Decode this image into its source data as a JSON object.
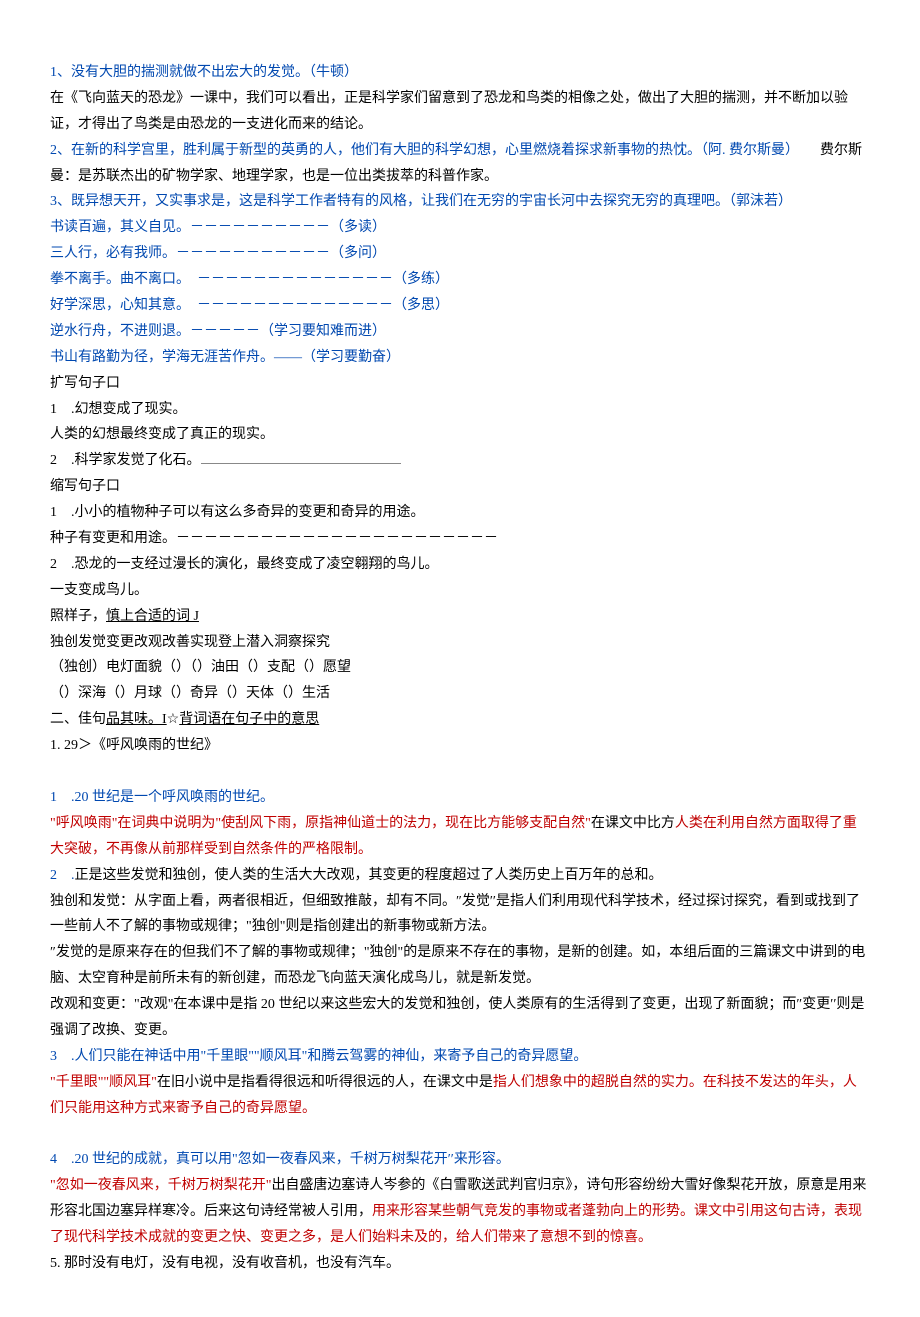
{
  "lines": [
    {
      "cls": "blue",
      "text": "1、没有大胆的揣测就做不出宏大的发觉。（牛顿）"
    },
    {
      "cls": "black",
      "text": "在《飞向蓝天的恐龙》一课中，我们可以看出，正是科学家们留意到了恐龙和鸟类的相像之处，做出了大胆的揣测，并不断加以验证，才得出了鸟类是由恐龙的一支进化而来的结论。"
    },
    {
      "cls": "mix",
      "parts": [
        {
          "cls": "blue",
          "text": "2、在新的科学宫里，胜利属于新型的英勇的人，他们有大胆的科学幻想，心里燃烧着探求新事物的热忱。（阿. 费尔斯曼）"
        },
        {
          "cls": "black",
          "text": "　　费尔斯曼：是苏联杰出的矿物学家、地理学家，也是一位出类拔萃的科普作家。"
        }
      ]
    },
    {
      "cls": "blue",
      "text": "3、既异想天开，又实事求是，这是科学工作者特有的风格，让我们在无穷的宇宙长河中去探究无穷的真理吧。（郭沫若）"
    },
    {
      "cls": "blue",
      "text": "书读百遍，其义自见。－－－－－－－－－－（多读）"
    },
    {
      "cls": "blue",
      "text": "三人行，必有我师。－－－－－－－－－－－（多问）"
    },
    {
      "cls": "blue",
      "text": "拳不离手。曲不离口。　－－－－－－－－－－－－－－（多练）"
    },
    {
      "cls": "blue",
      "text": "好学深思，心知其意。　－－－－－－－－－－－－－－（多思）"
    },
    {
      "cls": "blue",
      "text": "逆水行舟，不进则退。－－－－－（学习要知难而进）"
    },
    {
      "cls": "blue",
      "text": "书山有路勤为径，学海无涯苦作舟。——（学习要勤奋）"
    },
    {
      "cls": "black",
      "text": "扩写句子口"
    },
    {
      "cls": "black",
      "text": "1　.幻想变成了现实。"
    },
    {
      "cls": "black",
      "text": "人类的幻想最终变成了真正的现实。"
    },
    {
      "cls": "mix",
      "parts": [
        {
          "cls": "black",
          "text": "2　.科学家发觉了化石。"
        },
        {
          "cls": "dash",
          "text": ""
        }
      ]
    },
    {
      "cls": "black",
      "text": "缩写句子口"
    },
    {
      "cls": "black",
      "text": "1　.小小的植物种子可以有这么多奇异的变更和奇异的用途。"
    },
    {
      "cls": "black",
      "text": "种子有变更和用途。－－－－－－－－－－－－－－－－－－－－－－－"
    },
    {
      "cls": "black",
      "text": "2　.恐龙的一支经过漫长的演化，最终变成了凌空翱翔的鸟儿。"
    },
    {
      "cls": "black",
      "text": "一支变成鸟儿。"
    },
    {
      "cls": "mix",
      "parts": [
        {
          "cls": "black",
          "text": "照样子，"
        },
        {
          "cls": "black u",
          "text": "慎上合适的词 J"
        }
      ]
    },
    {
      "cls": "black",
      "text": "独创发觉变更改观改善实现登上潜入洞察探究"
    },
    {
      "cls": "black",
      "text": "（独创）电灯面貌（）（）油田（）支配（）愿望"
    },
    {
      "cls": "black",
      "text": "（）深海（）月球（）奇异（）天体（）生活"
    },
    {
      "cls": "mix",
      "parts": [
        {
          "cls": "black",
          "text": "二、佳句"
        },
        {
          "cls": "black u",
          "text": "品其味。I"
        },
        {
          "cls": "black",
          "text": "☆"
        },
        {
          "cls": "black u",
          "text": "背词语在句子中的意思"
        }
      ]
    },
    {
      "cls": "black",
      "text": "1. 29＞《呼风唤雨的世纪》"
    },
    {
      "cls": "black",
      "text": ""
    },
    {
      "cls": "blue",
      "text": "1　.20 世纪是一个呼风唤雨的世纪。"
    },
    {
      "cls": "mix",
      "parts": [
        {
          "cls": "red",
          "text": "\"呼风唤雨\"在词典中说明为\"使刮风下雨，原指神仙道士的法力，现在比方能够支配自然\""
        },
        {
          "cls": "black",
          "text": "在课文中比方"
        },
        {
          "cls": "red",
          "text": "人类在利用自然方面取得了重大突破，不再像从前那样受到自然条件的严格限制。"
        }
      ]
    },
    {
      "cls": "mix",
      "parts": [
        {
          "cls": "blue",
          "text": "2　."
        },
        {
          "cls": "black",
          "text": "正是这些发觉和独创，使人类的生活大大改观，其变更的程度超过了人类历史上百万年的总和。"
        }
      ]
    },
    {
      "cls": "black",
      "text": "独创和发觉：从字面上看，两者很相近，但细致推敲，却有不同。″发觉′′是指人们利用现代科学技术，经过探讨探究，看到或找到了一些前人不了解的事物或规律；\"独创\"则是指创建出的新事物或新方法。"
    },
    {
      "cls": "black",
      "text": "″发觉的是原来存在的但我们不了解的事物或规律；\"独创\"的是原来不存在的事物，是新的创建。如，本组后面的三篇课文中讲到的电脑、太空育种是前所未有的新创建，而恐龙飞向蓝天演化成鸟儿，就是新发觉。"
    },
    {
      "cls": "black",
      "text": "改观和变更：\"改观\"在本课中是指 20 世纪以来这些宏大的发觉和独创，使人类原有的生活得到了变更，出现了新面貌；而″变更′′则是强调了改换、变更。"
    },
    {
      "cls": "blue",
      "text": "3　.人们只能在神话中用\"千里眼\"\"顺风耳\"和腾云驾雾的神仙，来寄予自己的奇异愿望。"
    },
    {
      "cls": "mix",
      "parts": [
        {
          "cls": "red",
          "text": "\"千里眼\"\"顺风耳\""
        },
        {
          "cls": "black",
          "text": "在旧小说中是指看得很远和听得很远的人，在课文中是"
        },
        {
          "cls": "red",
          "text": "指人们想象中的超脱自然的实力。在科技不发达的年头，人们只能用这种方式来寄予自己的奇异愿望。"
        }
      ]
    },
    {
      "cls": "black",
      "text": ""
    },
    {
      "cls": "blue",
      "text": "4　.20 世纪的成就，真可以用\"忽如一夜春风来，千树万树梨花开′′来形容。"
    },
    {
      "cls": "mix",
      "parts": [
        {
          "cls": "red",
          "text": "\"忽如一夜春风来，千树万树梨花开\""
        },
        {
          "cls": "black",
          "text": "出自盛唐边塞诗人岑参的《白雪歌送武判官归京》，诗句形容纷纷大雪好像梨花开放，原意是用来形容北国边塞异样寒冷。后来这句诗经常被人引用，"
        },
        {
          "cls": "red",
          "text": "用来形容某些朝气竞发的事物或者蓬勃向上的形势。课文中引用这句古诗，表现了现代科学技术成就的变更之快、变更之多，是人们始料未及的，给人们带来了意想不到的惊喜。"
        }
      ]
    },
    {
      "cls": "black",
      "text": "5. 那时没有电灯，没有电视，没有收音机，也没有汽车。"
    }
  ]
}
